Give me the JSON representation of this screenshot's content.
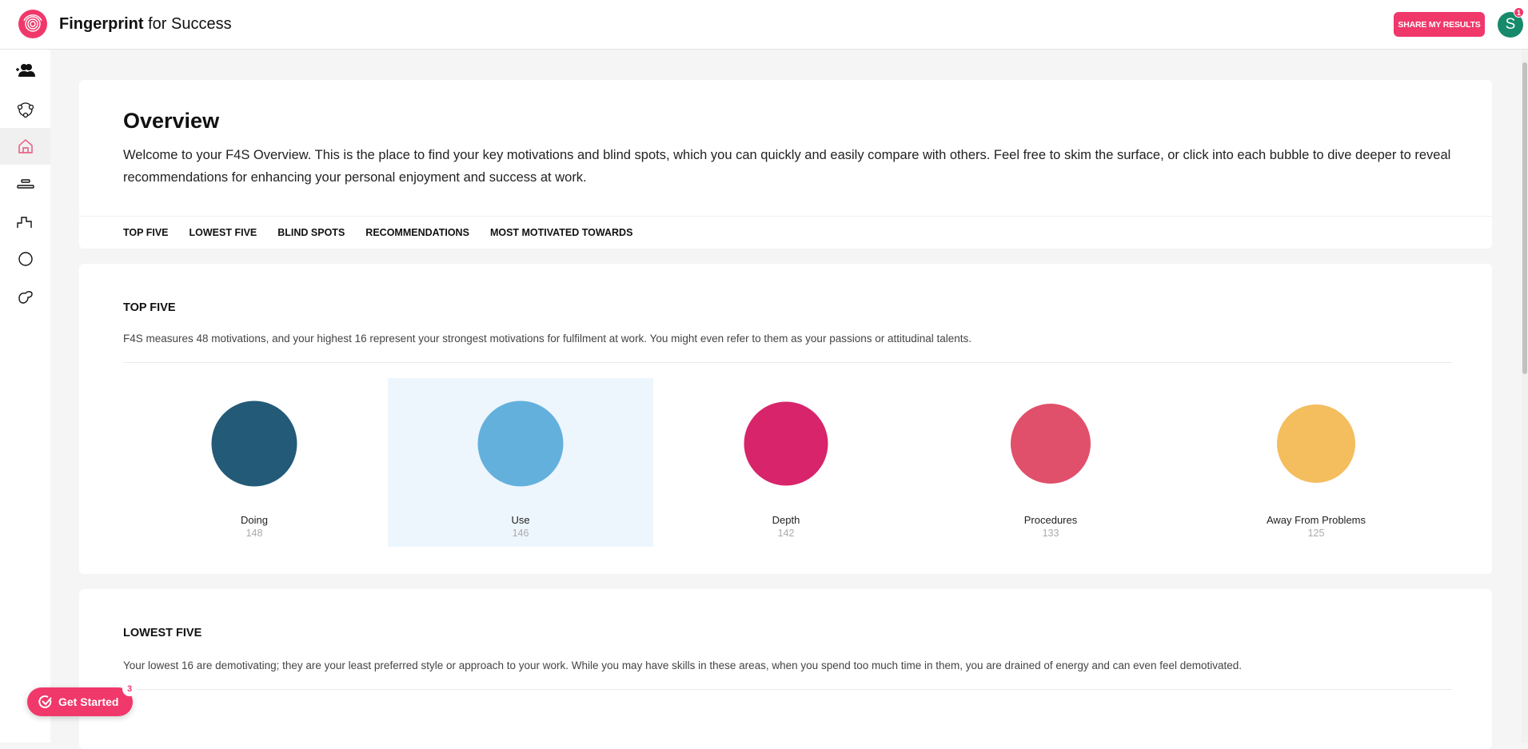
{
  "header": {
    "brand_bold": "Fingerprint",
    "brand_rest": " for Success",
    "share_label": "SHARE MY RESULTS",
    "avatar_initial": "S",
    "notification_count": "1"
  },
  "sidebar": {
    "items": [
      {
        "icon": "add-team-icon"
      },
      {
        "icon": "network-icon"
      },
      {
        "icon": "home-icon",
        "active": true
      },
      {
        "icon": "stack-icon"
      },
      {
        "icon": "steps-icon"
      },
      {
        "icon": "circle-icon"
      },
      {
        "icon": "blob-icon"
      }
    ]
  },
  "overview": {
    "title": "Overview",
    "intro": "Welcome to your F4S Overview. This is the place to find your key motivations and blind spots, which you can quickly and easily compare with others. Feel free to skim the surface, or click into each bubble to dive deeper to reveal recommendations for enhancing your personal enjoyment and success at work.",
    "tabs": [
      "TOP FIVE",
      "LOWEST FIVE",
      "BLIND SPOTS",
      "RECOMMENDATIONS",
      "MOST MOTIVATED TOWARDS"
    ]
  },
  "top_five": {
    "heading": "TOP FIVE",
    "description": "F4S measures 48 motivations, and your highest 16 represent your strongest motivations for fulfilment at work. You might even refer to them as your passions or attitudinal talents.",
    "items": [
      {
        "label": "Doing",
        "score": "148",
        "color": "#235a78"
      },
      {
        "label": "Use",
        "score": "146",
        "color": "#64b0dd",
        "selected": true
      },
      {
        "label": "Depth",
        "score": "142",
        "color": "#d8246a"
      },
      {
        "label": "Procedures",
        "score": "133",
        "color": "#e0506a"
      },
      {
        "label": "Away From Problems",
        "score": "125",
        "color": "#f4bd5e"
      }
    ]
  },
  "lowest_five": {
    "heading": "LOWEST FIVE",
    "description": "Your lowest 16 are demotivating; they are your least preferred style or approach to your work. While you may have skills in these areas, when you spend too much time in them, you are drained of energy and can even feel demotivated."
  },
  "get_started": {
    "label": "Get Started",
    "count": "3"
  }
}
